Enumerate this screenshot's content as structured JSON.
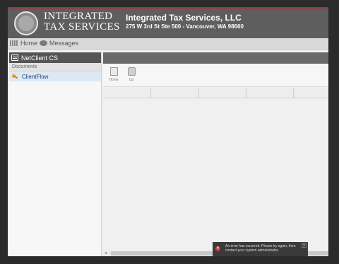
{
  "header": {
    "logo_line1": "INTEGRATED",
    "logo_line2": "TAX SERVICES",
    "company_name": "Integrated Tax Services, LLC",
    "company_address": "275 W 3rd St Ste 500 - Vancouver, WA 98660"
  },
  "nav": {
    "home_label": "Home",
    "messages_label": "Messages"
  },
  "sidebar": {
    "title": "NetClient CS",
    "section": "Documents",
    "items": [
      {
        "label": "ClientFlow",
        "icon": "key-icon"
      }
    ]
  },
  "toolbar": {
    "home_label": "Home",
    "up_label": "Up"
  },
  "toast": {
    "message": "An error has occurred. Please try again, then contact your system administrator.",
    "close": "x"
  },
  "colors": {
    "accent_bar": "#c0272d",
    "header_bg": "#5e5e5e",
    "sidebar_title_bg": "#555555",
    "selected_item_bg": "#dde8f5",
    "error_icon": "#d23a3a"
  }
}
